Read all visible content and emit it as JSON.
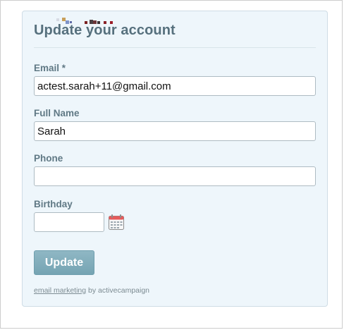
{
  "form": {
    "title": "Update your account",
    "fields": {
      "email": {
        "label": "Email *",
        "value": "actest.sarah+11@gmail.com"
      },
      "full_name": {
        "label": "Full Name",
        "value": "Sarah"
      },
      "phone": {
        "label": "Phone",
        "value": ""
      },
      "birthday": {
        "label": "Birthday",
        "value": ""
      }
    },
    "submit_label": "Update",
    "footer": {
      "link_text": "email marketing",
      "suffix_text": " by activecampaign"
    }
  },
  "colors": {
    "card_background": "#eef6fb",
    "heading": "#56707d",
    "label": "#607985",
    "button": "#7fadbb",
    "footer_text": "#7c8b92"
  },
  "icons": {
    "calendar": "calendar-icon"
  }
}
